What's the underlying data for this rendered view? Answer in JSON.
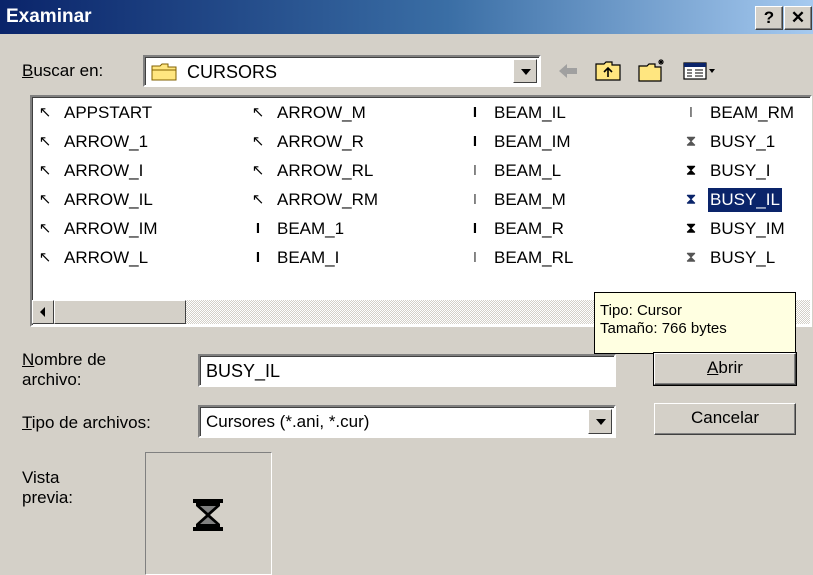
{
  "window": {
    "title": "Examinar",
    "help_label": "?",
    "close_label": "✕"
  },
  "lookin": {
    "label_accel": "B",
    "label_rest": "uscar en:",
    "folder": "CURSORS"
  },
  "toolbar": {
    "back_icon": "back-arrow-icon",
    "up_icon": "up-folder-icon",
    "new_folder_icon": "new-folder-icon",
    "view_icon": "view-menu-icon"
  },
  "files": {
    "col1": [
      {
        "name": "APPSTART",
        "icon": "↖"
      },
      {
        "name": "ARROW_1",
        "icon": "↖"
      },
      {
        "name": "ARROW_I",
        "icon": "↖"
      },
      {
        "name": "ARROW_IL",
        "icon": "↖"
      },
      {
        "name": "ARROW_IM",
        "icon": "↖"
      },
      {
        "name": "ARROW_L",
        "icon": "↖"
      }
    ],
    "col2": [
      {
        "name": "ARROW_M",
        "icon": "↖"
      },
      {
        "name": "ARROW_R",
        "icon": "↖"
      },
      {
        "name": "ARROW_RL",
        "icon": "↖"
      },
      {
        "name": "ARROW_RM",
        "icon": "↖"
      },
      {
        "name": "BEAM_1",
        "icon": "I"
      },
      {
        "name": "BEAM_I",
        "icon": "I"
      }
    ],
    "col3": [
      {
        "name": "BEAM_IL",
        "icon": "I"
      },
      {
        "name": "BEAM_IM",
        "icon": "I"
      },
      {
        "name": "BEAM_L",
        "icon": "I"
      },
      {
        "name": "BEAM_M",
        "icon": "I"
      },
      {
        "name": "BEAM_R",
        "icon": "I"
      },
      {
        "name": "BEAM_RL",
        "icon": "I"
      }
    ],
    "col4": [
      {
        "name": "BEAM_RM",
        "icon": "I"
      },
      {
        "name": "BUSY_1",
        "icon": "⧗"
      },
      {
        "name": "BUSY_I",
        "icon": "⧗"
      },
      {
        "name": "BUSY_IL",
        "icon": "⧗"
      },
      {
        "name": "BUSY_IM",
        "icon": "⧗"
      },
      {
        "name": "BUSY_L",
        "icon": "⧗"
      }
    ],
    "selected": "BUSY_IL"
  },
  "tooltip": {
    "line1": "Tipo: Cursor",
    "line2": "Tamaño: 766 bytes"
  },
  "filename": {
    "label_accel": "N",
    "label_rest1": "ombre de",
    "label_line2": "archivo:",
    "value": "BUSY_IL"
  },
  "filetype": {
    "label_accel": "T",
    "label_rest": "ipo de archivos:",
    "value": "Cursores (*.ani, *.cur)"
  },
  "buttons": {
    "open_accel": "A",
    "open_rest": "brir",
    "cancel": "Cancelar"
  },
  "preview": {
    "label_line1": "Vista",
    "label_line2": "previa:",
    "icon": "hourglass-icon"
  },
  "colors": {
    "selection": "#0a246a",
    "tooltip_bg": "#ffffe1",
    "face": "#d4d0c8"
  }
}
